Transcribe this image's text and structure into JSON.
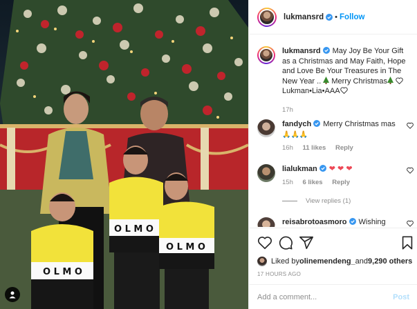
{
  "post": {
    "author": "lukmansrd",
    "follow_label": "Follow",
    "separator": "•"
  },
  "caption": {
    "username": "lukmansrd",
    "text_line": "May Joy Be Your Gift as a Christmas and May Faith, Hope and Love Be Your Treasures in The New Year .. ",
    "text_tail": " Merry Christmas",
    "signoff": "Lukman•Lia•AAA",
    "time": "17h"
  },
  "comments": [
    {
      "username": "fandych",
      "text": "Merry Christmas mas ",
      "emoji": "🙏🙏🙏",
      "time": "16h",
      "likes": "11 likes",
      "reply": "Reply"
    },
    {
      "username": "lialukman",
      "text": "",
      "emoji": "",
      "time": "15h",
      "likes": "6 likes",
      "reply": "Reply"
    },
    {
      "username": "reisabrotoasmoro",
      "text": "Wishing"
    }
  ],
  "view_replies": "View replies (1)",
  "likes_line": {
    "prefix": "Liked by ",
    "user": "olinemendeng_",
    "middle": " and ",
    "count": "9,290 others"
  },
  "timestamp": "17 HOURS AGO",
  "add_comment": {
    "placeholder": "Add a comment...",
    "post_label": "Post"
  },
  "colors": {
    "accent": "#0095f6",
    "heart": "#ed4956",
    "post_disabled": "#b2dffc"
  },
  "icons": [
    "verified-icon",
    "heart-icon",
    "comment-icon",
    "share-icon",
    "bookmark-icon",
    "user-tag-icon"
  ]
}
